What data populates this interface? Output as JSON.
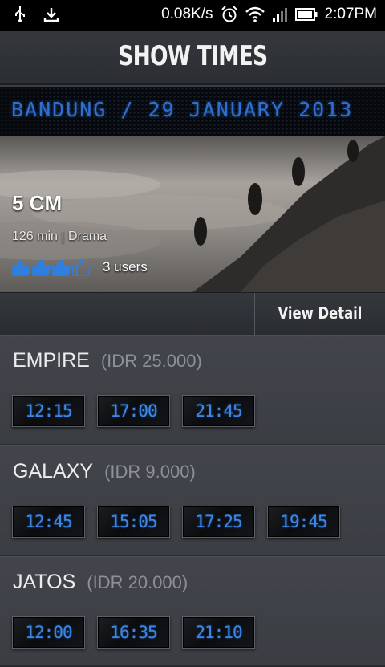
{
  "status_bar": {
    "net_speed": "0.08K/s",
    "time": "2:07PM",
    "icons": [
      "usb-icon",
      "download-icon",
      "alarm-icon",
      "wifi-icon",
      "signal-icon",
      "battery-icon"
    ]
  },
  "header": {
    "title": "SHOW TIMES"
  },
  "marquee": {
    "text": "BANDUNG / 29 JANUARY 2013"
  },
  "movie": {
    "title": "5 CM",
    "duration": "126  min",
    "genre": "Drama",
    "rating_thumbs": 4,
    "rating_users": "3 users"
  },
  "detail": {
    "button_label": "View Detail"
  },
  "cinemas": [
    {
      "name": "EMPIRE",
      "price": "(IDR 25.000)",
      "times": [
        "12:15",
        "17:00",
        "21:45"
      ]
    },
    {
      "name": "GALAXY",
      "price": "(IDR 9.000)",
      "times": [
        "12:45",
        "15:05",
        "17:25",
        "19:45"
      ]
    },
    {
      "name": "JATOS",
      "price": "(IDR 20.000)",
      "times": [
        "12:00",
        "16:35",
        "21:10"
      ]
    }
  ],
  "colors": {
    "accent_blue": "#3c86e6",
    "header_bg": "#2f3237",
    "body_bg": "#3a3d43"
  }
}
